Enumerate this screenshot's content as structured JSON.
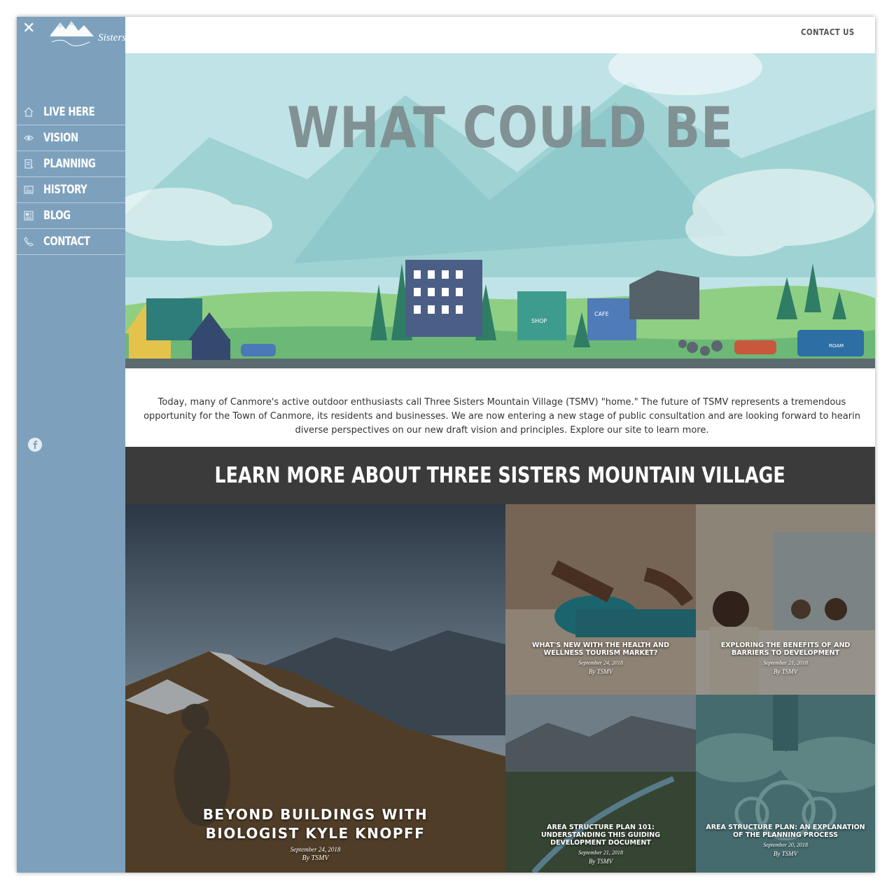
{
  "header": {
    "contact_label": "CONTACT US"
  },
  "brand": {
    "logo_text": "Sisters"
  },
  "sidebar": {
    "items": [
      {
        "label": "LIVE HERE",
        "icon": "home-icon"
      },
      {
        "label": "VISION",
        "icon": "eye-icon"
      },
      {
        "label": "PLANNING",
        "icon": "document-icon"
      },
      {
        "label": "HISTORY",
        "icon": "newspaper-icon"
      },
      {
        "label": "BLOG",
        "icon": "blog-icon"
      },
      {
        "label": "CONTACT",
        "icon": "phone-icon"
      }
    ],
    "social": "facebook-icon"
  },
  "hero": {
    "title": "WHAT COULD BE",
    "signs": {
      "shop": "SHOP",
      "cafe": "CAFE",
      "bus": "ROAM"
    }
  },
  "intro": {
    "text": "Today, many of Canmore's active outdoor enthusiasts call Three Sisters Mountain Village (TSMV) \"home.\"  The future of TSMV represents a tremendous\nopportunity for the Town of Canmore, its residents and businesses. We are now entering a new stage of public consultation and are looking forward to hearin\ndiverse perspectives on our new draft vision and principles. Explore our site to learn more."
  },
  "learn_more": {
    "title": "LEARN MORE ABOUT THREE SISTERS MOUNTAIN VILLAGE"
  },
  "posts": [
    {
      "title": "BEYOND BUILDINGS WITH BIOLOGIST KYLE KNOPFF",
      "date": "September 24, 2018",
      "author": "By TSMV"
    },
    {
      "title": "WHAT'S NEW WITH THE HEALTH AND WELLNESS TOURISM MARKET?",
      "date": "September 24, 2018",
      "author": "By TSMV"
    },
    {
      "title": "EXPLORING THE BENEFITS OF AND BARRIERS TO DEVELOPMENT",
      "date": "September 21, 2018",
      "author": "By TSMV"
    },
    {
      "title": "AREA STRUCTURE PLAN 101: UNDERSTANDING THIS GUIDING DEVELOPMENT DOCUMENT",
      "date": "September 21, 2018",
      "author": "By TSMV"
    },
    {
      "title": "AREA STRUCTURE PLAN: AN EXPLANATION OF THE PLANNING PROCESS",
      "date": "September 20, 2018",
      "author": "By TSMV"
    }
  ],
  "colors": {
    "sidebar": "#7da1bd",
    "hero_sky": "#bfe3e6",
    "learn_bar": "#3b3b3b"
  }
}
